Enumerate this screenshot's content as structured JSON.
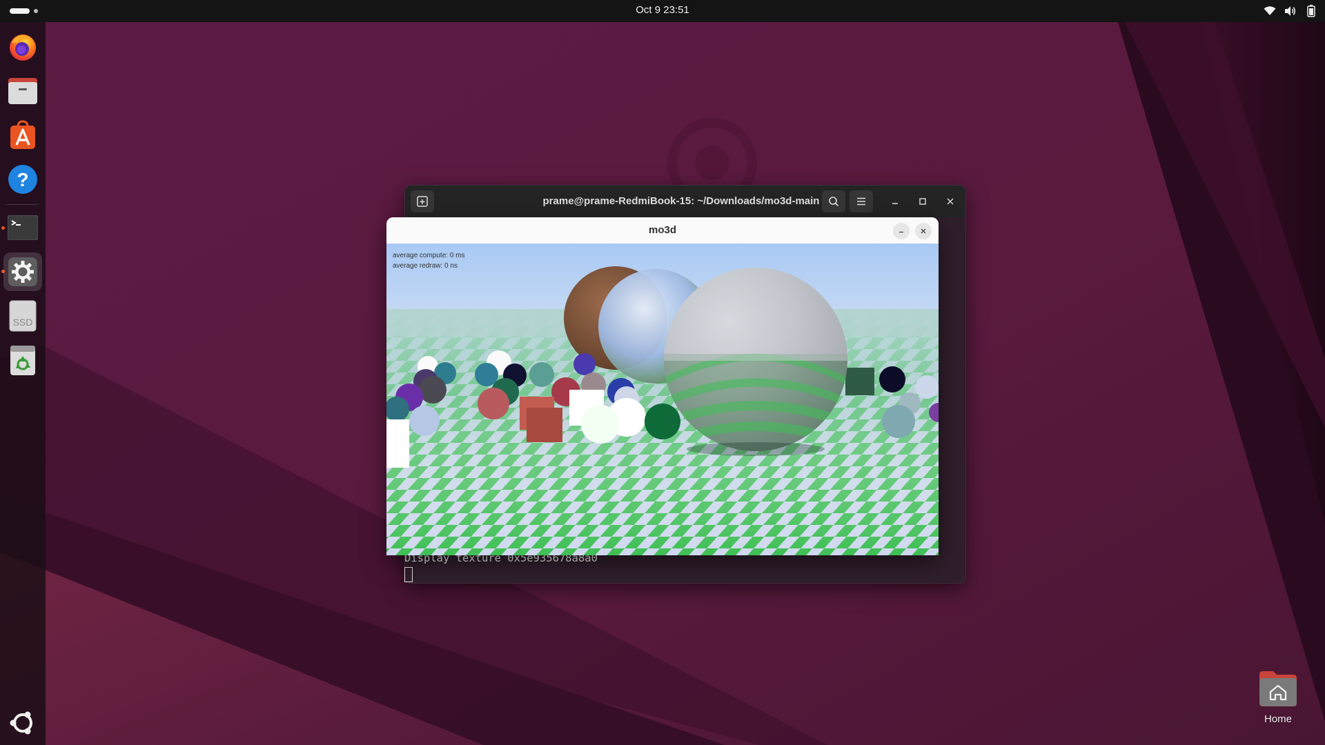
{
  "topbar": {
    "clock": "Oct 9  23:51",
    "tray_icons": [
      "wifi-icon",
      "volume-icon",
      "battery-icon"
    ]
  },
  "dock": {
    "apps": [
      {
        "name": "Firefox",
        "icon": "firefox-icon",
        "running": false
      },
      {
        "name": "Files",
        "icon": "files-icon",
        "running": false
      },
      {
        "name": "App Center",
        "icon": "app-center-icon",
        "running": false
      },
      {
        "name": "Help",
        "icon": "help-icon",
        "running": false
      },
      {
        "name": "Terminal",
        "icon": "terminal-icon",
        "running": true
      },
      {
        "name": "Settings",
        "icon": "settings-icon",
        "running": true,
        "active": true
      },
      {
        "name": "SSD",
        "icon": "drive-icon",
        "label": "SSD",
        "running": false
      },
      {
        "name": "Trash",
        "icon": "trash-icon",
        "running": false
      }
    ],
    "show_apps_icon": "ubuntu-logo-icon"
  },
  "terminal": {
    "title": "prame@prame-RedmiBook-15: ~/Downloads/mo3d-main",
    "output_line": "Display texture 0x5e935678a8a0"
  },
  "mo3d": {
    "title": "mo3d",
    "stats": {
      "compute": "average compute: 0 ms",
      "redraw": "average redraw: 0 ns"
    }
  },
  "desktop": {
    "home_label": "Home"
  },
  "colors": {
    "accent": "#e95420",
    "wallpaper": "#5a1a3e",
    "topbar": "#141414",
    "terminal_bg": "#301e2c"
  }
}
